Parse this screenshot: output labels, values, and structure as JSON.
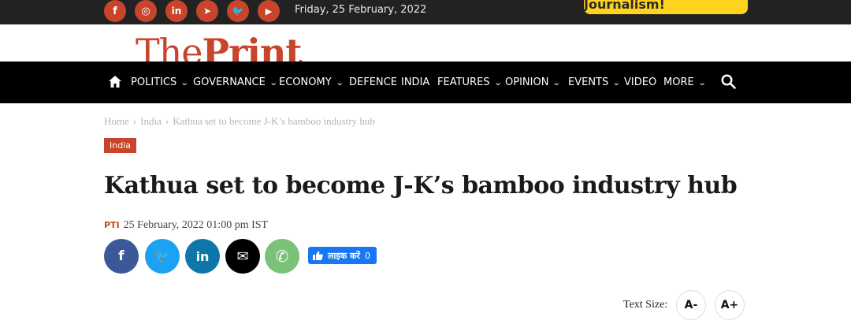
{
  "topbar": {
    "social": [
      {
        "icon": "facebook-icon",
        "glyph": "f"
      },
      {
        "icon": "instagram-icon",
        "glyph": "◎"
      },
      {
        "icon": "linkedin-icon",
        "glyph": "in"
      },
      {
        "icon": "telegram-icon",
        "glyph": "➤"
      },
      {
        "icon": "twitter-icon",
        "glyph": "🐦"
      },
      {
        "icon": "youtube-icon",
        "glyph": "▶"
      }
    ],
    "date": "Friday, 25 February, 2022",
    "support_label": "Support our Journalism!"
  },
  "logo": {
    "part1": "The",
    "part2": "Print"
  },
  "nav": {
    "items": [
      {
        "label": "POLITICS",
        "dropdown": true
      },
      {
        "label": "GOVERNANCE",
        "dropdown": true
      },
      {
        "label": "ECONOMY",
        "dropdown": true
      },
      {
        "label": "DEFENCE",
        "dropdown": false
      },
      {
        "label": "INDIA",
        "dropdown": false
      },
      {
        "label": "FEATURES",
        "dropdown": true
      },
      {
        "label": "OPINION",
        "dropdown": true
      },
      {
        "label": "EVENTS",
        "dropdown": true
      },
      {
        "label": "VIDEO",
        "dropdown": false
      },
      {
        "label": "MORE",
        "dropdown": true
      }
    ]
  },
  "breadcrumb": {
    "home": "Home",
    "section": "India",
    "current": "Kathua set to become J-K’s bamboo industry hub",
    "separator": "›"
  },
  "article": {
    "category": "India",
    "title": "Kathua set to become J-K’s bamboo industry hub",
    "author": "PTI",
    "date": "25 February, 2022 01:00 pm IST"
  },
  "share": {
    "buttons": [
      {
        "icon": "facebook-icon",
        "glyph": "f",
        "color": "#3b5998"
      },
      {
        "icon": "twitter-icon",
        "glyph": "🐦",
        "color": "#1da1f2"
      },
      {
        "icon": "linkedin-icon",
        "glyph": "in",
        "color": "#0e76a8"
      },
      {
        "icon": "email-icon",
        "glyph": "✉",
        "color": "#000000"
      },
      {
        "icon": "whatsapp-icon",
        "glyph": "✆",
        "color": "#7ac27a"
      }
    ],
    "like_label": "लाइक करें",
    "like_count": "0"
  },
  "text_size": {
    "label": "Text Size:",
    "decrease": "A-",
    "increase": "A+"
  },
  "colors": {
    "brand": "#c8442a",
    "nav_bg": "#000000",
    "topbar_bg": "#222222",
    "support_bg": "#ffd21f"
  }
}
